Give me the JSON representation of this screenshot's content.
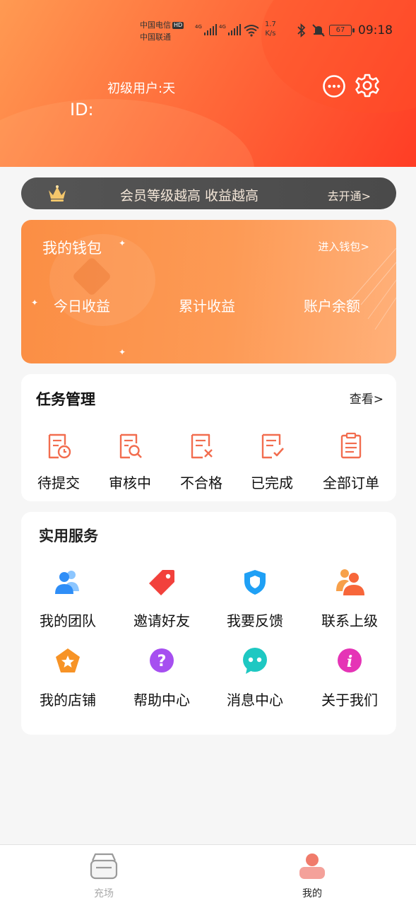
{
  "status_bar": {
    "carrier1": "中国电信",
    "hd": "HD",
    "carrier2": "中国联通",
    "net1": "4G",
    "net2": "4G",
    "speed_value": "1.7",
    "speed_unit": "K/s",
    "battery": "67",
    "time": "09:18"
  },
  "header": {
    "user_level": "初级用户:天",
    "user_id_label": "ID:"
  },
  "vip_banner": {
    "text": "会员等级越高 收益越高",
    "action": "去开通>"
  },
  "wallet": {
    "title": "我的钱包",
    "enter": "进入钱包>",
    "stats": [
      "今日收益",
      "累计收益",
      "账户余额"
    ]
  },
  "tasks": {
    "title": "任务管理",
    "more": "查看>",
    "items": [
      {
        "label": "待提交",
        "icon": "pending-submit-icon"
      },
      {
        "label": "审核中",
        "icon": "reviewing-icon"
      },
      {
        "label": "不合格",
        "icon": "rejected-icon"
      },
      {
        "label": "已完成",
        "icon": "completed-icon"
      },
      {
        "label": "全部订单",
        "icon": "all-orders-icon"
      }
    ],
    "icon_color": "#f26d4f"
  },
  "services": {
    "title": "实用服务",
    "items": [
      {
        "label": "我的团队",
        "icon": "team-icon",
        "color": "#2f8ef7"
      },
      {
        "label": "邀请好友",
        "icon": "tag-icon",
        "color": "#f2413c"
      },
      {
        "label": "我要反馈",
        "icon": "shield-icon",
        "color": "#1fa0f5"
      },
      {
        "label": "联系上级",
        "icon": "contact-superior-icon",
        "color": "#f7663a"
      },
      {
        "label": "我的店铺",
        "icon": "store-star-icon",
        "color": "#f79326"
      },
      {
        "label": "帮助中心",
        "icon": "help-icon",
        "color": "#a64ff0"
      },
      {
        "label": "消息中心",
        "icon": "message-icon",
        "color": "#1ec8c2"
      },
      {
        "label": "关于我们",
        "icon": "info-icon",
        "color": "#e534b6"
      }
    ]
  },
  "nav": {
    "items": [
      {
        "label": "充场",
        "icon": "store-icon",
        "active": false
      },
      {
        "label": "我的",
        "icon": "user-icon",
        "active": true
      }
    ]
  },
  "colors": {
    "header_start": "#ff9a52",
    "header_end": "#ff3d25",
    "wallet": "#fd9a55",
    "vip_bg": "#4f4f4f",
    "nav_active": "#f07b6b",
    "nav_inactive": "#aaaaaa"
  }
}
